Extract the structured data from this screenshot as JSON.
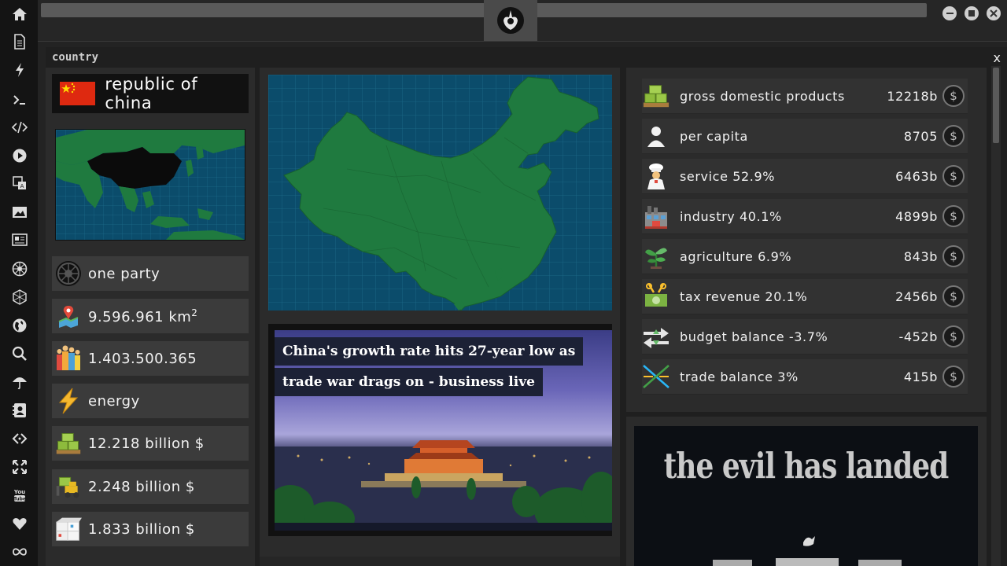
{
  "window": {
    "title": "country",
    "close": "x"
  },
  "sidebar": {
    "icons": [
      "home-icon",
      "document-icon",
      "bolt-icon",
      "terminal-icon",
      "code-icon",
      "play-icon",
      "translate-icon",
      "image-icon",
      "newspaper-icon",
      "empire-icon",
      "hexagon-icon",
      "globe-icon",
      "search-icon",
      "umbrella-icon",
      "contact-icon",
      "link-icon",
      "expand-icon",
      "youtube-icon",
      "heart-icon",
      "infinity-icon"
    ]
  },
  "country": {
    "name": "republic of china",
    "flag_color": "#de2910",
    "stats": [
      {
        "icon": "empire-icon",
        "text": "one party"
      },
      {
        "icon": "map-pin-icon",
        "text": "9.596.961 km",
        "sup": "2"
      },
      {
        "icon": "population-icon",
        "text": "1.403.500.365"
      },
      {
        "icon": "energy-icon",
        "text": "energy"
      },
      {
        "icon": "money-pallet-icon",
        "text": "12.218 billion $"
      },
      {
        "icon": "forklift-icon",
        "text": "2.248 billion $"
      },
      {
        "icon": "boxes-icon",
        "text": "1.833 billion $"
      }
    ]
  },
  "news": {
    "headline_line1": "China's growth rate hits 27-year low as",
    "headline_line2": "trade war drags on - business live"
  },
  "economy": {
    "rows": [
      {
        "icon": "money-pallet-icon",
        "label": "gross domestic products",
        "value": "12218b"
      },
      {
        "icon": "person-icon",
        "label": "per capita",
        "value": "8705"
      },
      {
        "icon": "chef-icon",
        "label": "service 52.9%",
        "value": "6463b"
      },
      {
        "icon": "factory-icon",
        "label": "industry 40.1%",
        "value": "4899b"
      },
      {
        "icon": "sprout-icon",
        "label": "agriculture 6.9%",
        "value": "843b"
      },
      {
        "icon": "tax-icon",
        "label": "tax revenue 20.1%",
        "value": "2456b"
      },
      {
        "icon": "balance-arrows-icon",
        "label": "budget balance -3.7%",
        "value": "-452b"
      },
      {
        "icon": "trade-icon",
        "label": "trade balance 3%",
        "value": "415b"
      }
    ],
    "coin_symbol": "$"
  },
  "promo": {
    "title": "the evil has landed"
  },
  "colors": {
    "accent": "#1e6f3a",
    "map_bg": "#0a4f6e",
    "panel": "#2b2b2b"
  }
}
